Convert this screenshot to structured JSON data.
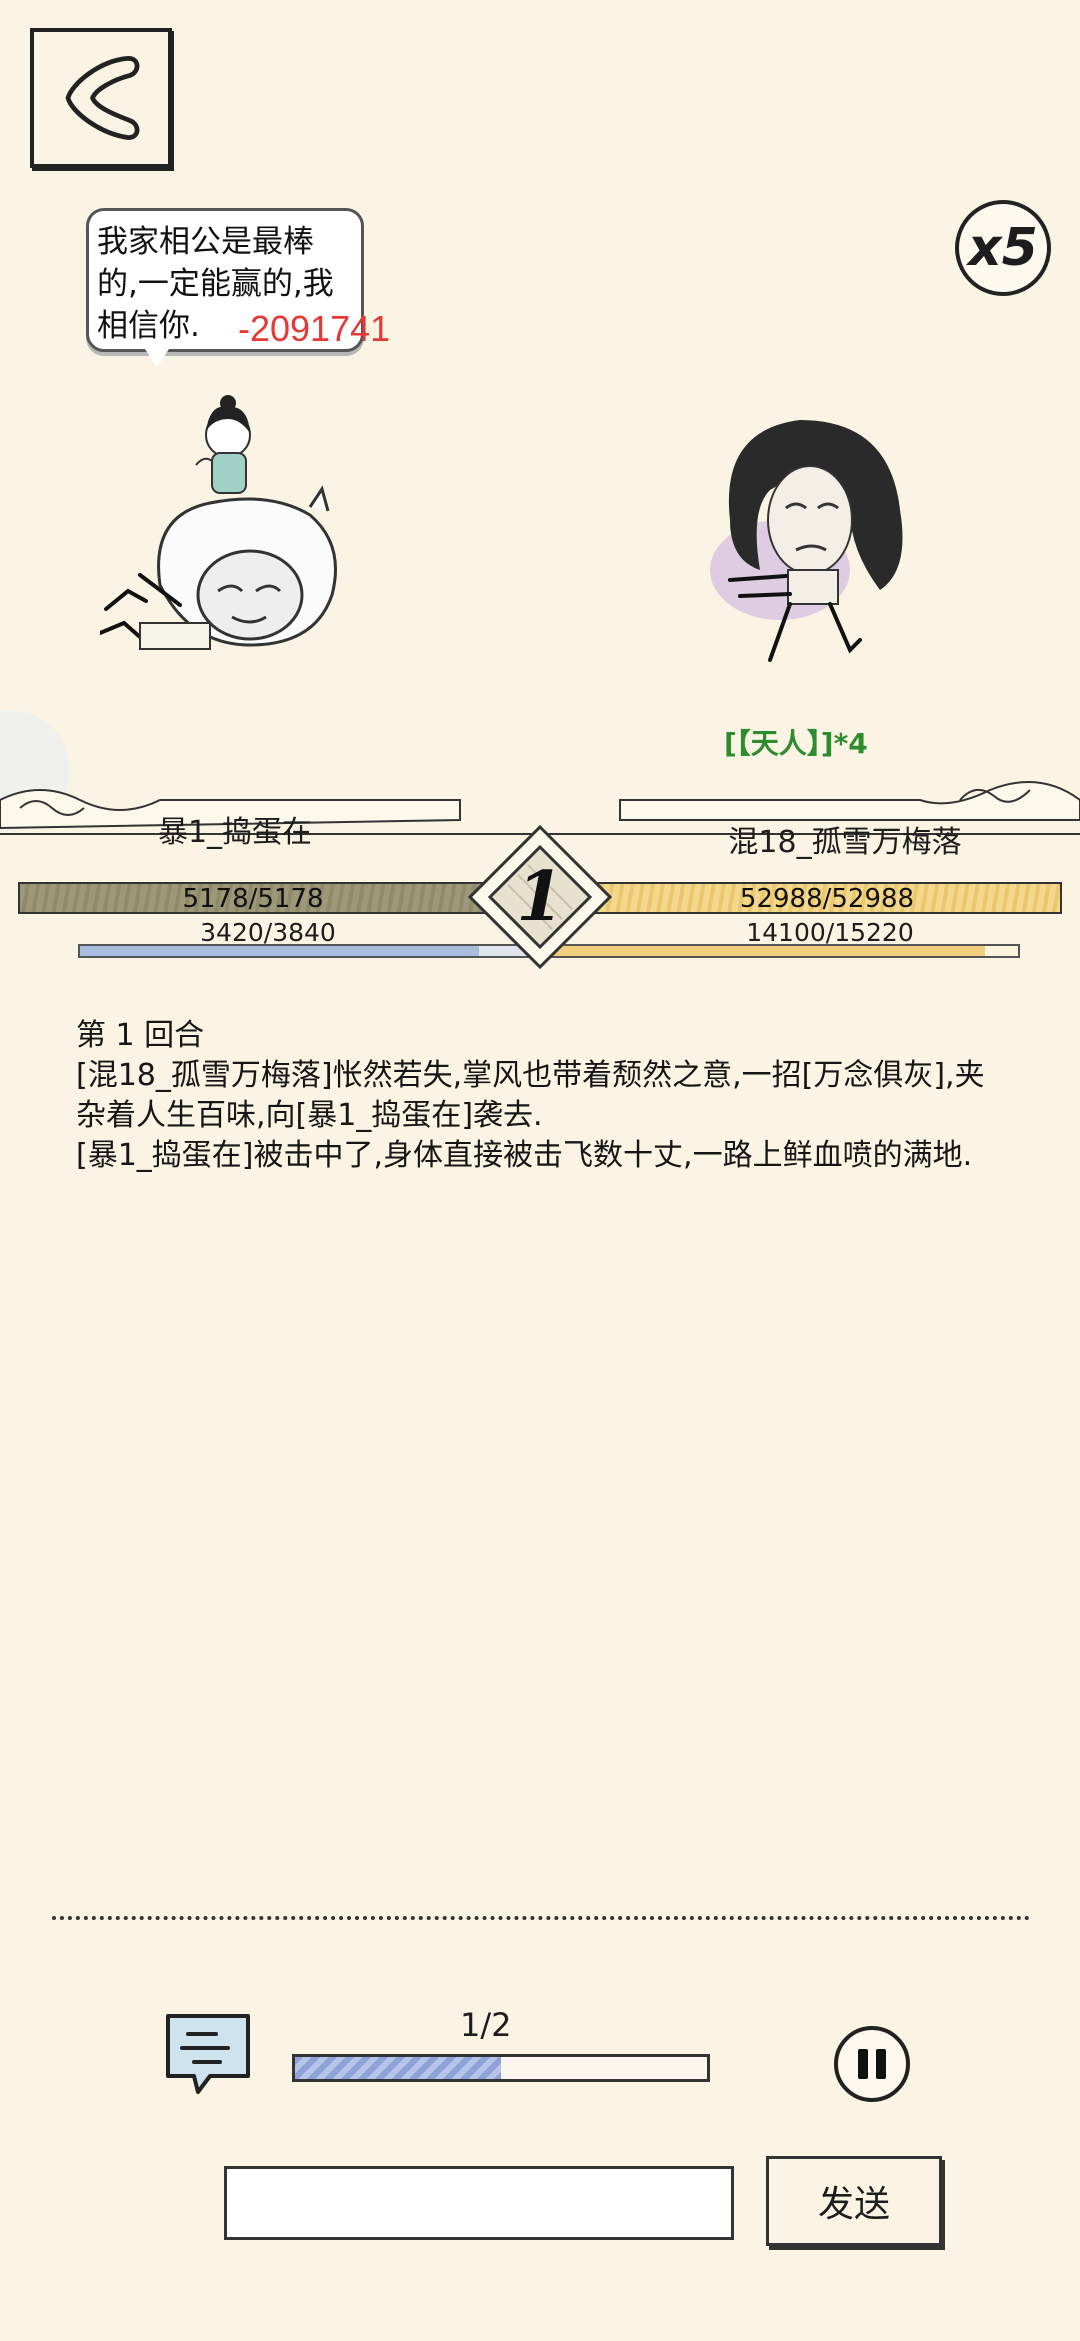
{
  "header": {
    "back_icon": "back-icon",
    "speed": "x5"
  },
  "dialogue": {
    "speech": "我家相公是最棒的,一定能赢的,我相信你.",
    "damage": "-2091741"
  },
  "enemy": {
    "buff": "[【天人】]*4"
  },
  "player": {
    "name": "暴1_捣蛋在",
    "hp_text": "5178/5178",
    "hp_fraction": 1.0,
    "mp_text": "3420/3840",
    "mp_fraction": 0.89
  },
  "opponent": {
    "name": "混18_孤雪万梅落",
    "hp_text": "52988/52988",
    "hp_fraction": 1.0,
    "mp_text": "14100/15220",
    "mp_fraction": 0.93
  },
  "round": {
    "number": "1"
  },
  "log": {
    "round_title": "第 1 回合",
    "lines": [
      "[混18_孤雪万梅落]怅然若失,掌风也带着颓然之意,一招[万念俱灰],夹杂着人生百味,向[暴1_捣蛋在]袭去.",
      "[暴1_捣蛋在]被击中了,身体直接被击飞数十丈,一路上鲜血喷的满地."
    ]
  },
  "controls": {
    "progress_label": "1/2",
    "progress_fraction": 0.5,
    "chat_icon": "chat-icon",
    "pause_icon": "pause-icon",
    "input_value": "",
    "send_label": "发送"
  },
  "colors": {
    "background": "#fbf4e4",
    "damage": "#e53935",
    "buff": "#2e8b2e"
  }
}
